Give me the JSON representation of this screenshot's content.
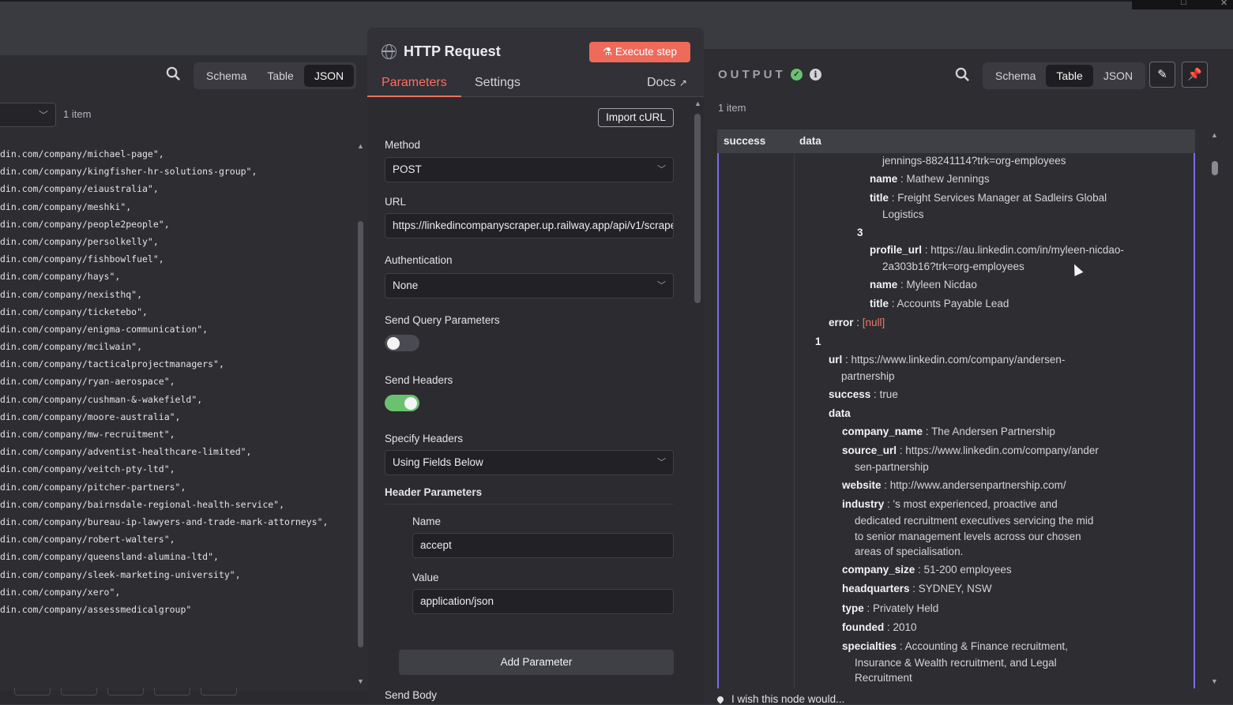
{
  "left": {
    "view_tabs": [
      "Schema",
      "Table",
      "JSON"
    ],
    "active_tab": "JSON",
    "items_count": "1 item",
    "json_lines": [
      "din.com/company/michael-page\",",
      "din.com/company/kingfisher-hr-solutions-group\",",
      "din.com/company/eiaustralia\",",
      "din.com/company/meshki\",",
      "din.com/company/people2people\",",
      "din.com/company/persolkelly\",",
      "din.com/company/fishbowlfuel\",",
      "din.com/company/hays\",",
      "din.com/company/nexisthq\",",
      "din.com/company/ticketebo\",",
      "din.com/company/enigma-communication\",",
      "din.com/company/mcilwain\",",
      "din.com/company/tacticalprojectmanagers\",",
      "din.com/company/ryan-aerospace\",",
      "din.com/company/cushman-&-wakefield\",",
      "din.com/company/moore-australia\",",
      "din.com/company/mw-recruitment\",",
      "din.com/company/adventist-healthcare-limited\",",
      "din.com/company/veitch-pty-ltd\",",
      "din.com/company/pitcher-partners\",",
      "din.com/company/bairnsdale-regional-health-service\",",
      "din.com/company/bureau-ip-lawyers-and-trade-mark-attorneys\",",
      "din.com/company/robert-walters\",",
      "din.com/company/queensland-alumina-ltd\",",
      "din.com/company/sleek-marketing-university\",",
      "din.com/company/xero\",",
      "din.com/company/assessmedicalgroup\""
    ]
  },
  "node": {
    "title": "HTTP Request",
    "execute_label": "Execute step",
    "tabs": [
      "Parameters",
      "Settings"
    ],
    "docs_label": "Docs",
    "import_curl_label": "Import cURL",
    "method_label": "Method",
    "method_value": "POST",
    "url_label": "URL",
    "url_value": "https://linkedincompanyscraper.up.railway.app/api/v1/scrape",
    "auth_label": "Authentication",
    "auth_value": "None",
    "send_query_label": "Send Query Parameters",
    "send_query_on": false,
    "send_headers_label": "Send Headers",
    "send_headers_on": true,
    "specify_headers_label": "Specify Headers",
    "specify_headers_value": "Using Fields Below",
    "header_params_label": "Header Parameters",
    "name_label": "Name",
    "name_value": "accept",
    "value_label": "Value",
    "value_value": "application/json",
    "add_param_label": "Add Parameter",
    "send_body_label": "Send Body"
  },
  "output": {
    "title": "OUTPUT",
    "view_tabs": [
      "Schema",
      "Table",
      "JSON"
    ],
    "active_tab": "Table",
    "items_count": "1 item",
    "columns": [
      "success",
      "data"
    ],
    "rows": [
      {
        "key": "",
        "val": "jennings-88241114?trk=org-employees"
      },
      {
        "key": "name",
        "val": "Mathew Jennings"
      },
      {
        "key": "title",
        "val": "Freight Services Manager at Sadleirs Global"
      },
      {
        "key": "",
        "val": "Logistics"
      },
      {
        "key": "3",
        "val": ""
      },
      {
        "key": "profile_url",
        "val": "https://au.linkedin.com/in/myleen-nicdao-"
      },
      {
        "key": "",
        "val": "2a303b16?trk=org-employees"
      },
      {
        "key": "name",
        "val": "Myleen Nicdao"
      },
      {
        "key": "title",
        "val": "Accounts Payable Lead"
      },
      {
        "key": "error",
        "val": "[null]"
      },
      {
        "key": "1",
        "val": ""
      },
      {
        "key": "url",
        "val": "https://www.linkedin.com/company/andersen-"
      },
      {
        "key": "",
        "val": "partnership"
      },
      {
        "key": "success",
        "val": "true"
      },
      {
        "key": "data",
        "val": ""
      },
      {
        "key": "company_name",
        "val": "The Andersen Partnership"
      },
      {
        "key": "source_url",
        "val": "https://www.linkedin.com/company/ander"
      },
      {
        "key": "",
        "val": "sen-partnership"
      },
      {
        "key": "website",
        "val": "http://www.andersenpartnership.com/"
      },
      {
        "key": "industry",
        "val": "'s most experienced, proactive and"
      },
      {
        "key": "",
        "val": "dedicated recruitment executives servicing the mid"
      },
      {
        "key": "",
        "val": "to senior management levels across our chosen"
      },
      {
        "key": "",
        "val": "areas of specialisation."
      },
      {
        "key": "company_size",
        "val": "51-200 employees"
      },
      {
        "key": "headquarters",
        "val": "SYDNEY, NSW"
      },
      {
        "key": "type",
        "val": "Privately Held"
      },
      {
        "key": "founded",
        "val": "2010"
      },
      {
        "key": "specialties",
        "val": "Accounting & Finance recruitment,"
      },
      {
        "key": "",
        "val": "Insurance & Wealth recruitment, and Legal"
      },
      {
        "key": "",
        "val": "Recruitment"
      }
    ],
    "feedback_label": "I wish this node would..."
  }
}
